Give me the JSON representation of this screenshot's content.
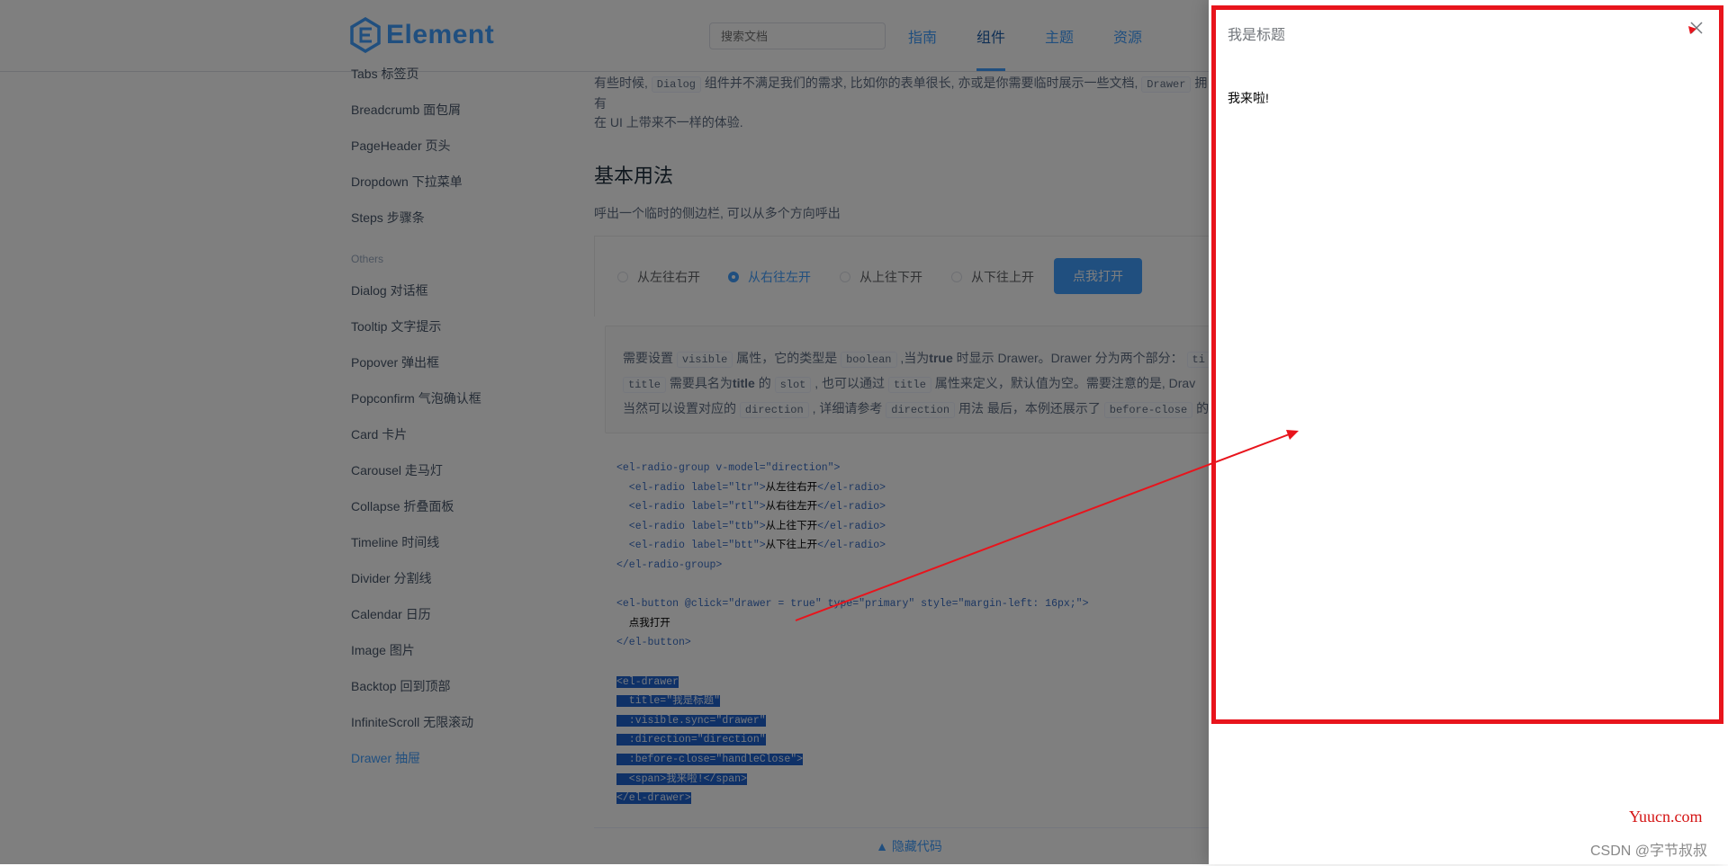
{
  "header": {
    "logo_text": "Element",
    "search_placeholder": "搜索文档",
    "nav": [
      "指南",
      "组件",
      "主题",
      "资源"
    ],
    "active_nav": "组件"
  },
  "sidebar": {
    "items_top": [
      "Tabs 标签页",
      "Breadcrumb 面包屑",
      "PageHeader 页头",
      "Dropdown 下拉菜单",
      "Steps 步骤条"
    ],
    "group_label": "Others",
    "items_others": [
      "Dialog 对话框",
      "Tooltip 文字提示",
      "Popover 弹出框",
      "Popconfirm 气泡确认框",
      "Card 卡片",
      "Carousel 走马灯",
      "Collapse 折叠面板",
      "Timeline 时间线",
      "Divider 分割线",
      "Calendar 日历",
      "Image 图片",
      "Backtop 回到顶部",
      "InfiniteScroll 无限滚动",
      "Drawer 抽屉"
    ],
    "active_item": "Drawer 抽屉"
  },
  "content": {
    "intro_a": "有些时候,",
    "intro_code1": "Dialog",
    "intro_b": "组件并不满足我们的需求, 比如你的表单很长, 亦或是你需要临时展示一些文档,",
    "intro_code2": "Drawer",
    "intro_c": "拥有",
    "intro_line2": "在 UI 上带来不一样的体验.",
    "section_title": "基本用法",
    "section_desc": "呼出一个临时的侧边栏, 可以从多个方向呼出",
    "radios": [
      {
        "label": "从左往右开",
        "checked": false
      },
      {
        "label": "从右往左开",
        "checked": true
      },
      {
        "label": "从上往下开",
        "checked": false
      },
      {
        "label": "从下往上开",
        "checked": false
      }
    ],
    "open_button": "点我打开",
    "desc": {
      "p1": "需要设置",
      "c1": "visible",
      "p2": "属性，它的类型是",
      "c2": "boolean",
      "p3": ",当为",
      "b1": "true",
      "p4": "时显示 Drawer。Drawer 分为两个部分：",
      "c3": "ti",
      "c4": "title",
      "p5": "需要具名为",
      "b2": "title",
      "p6": "的",
      "c5": "slot",
      "p7": ", 也可以通过",
      "c6": "title",
      "p8": "属性来定义，默认值为空。需要注意的是, Drav",
      "p9": "当然可以设置对应的",
      "c7": "direction",
      "p10": ", 详细请参考",
      "c8": "direction",
      "p11": "用法 最后，本例还展示了",
      "c9": "before-close",
      "p12": "的"
    },
    "code_lines": [
      "<el-radio-group v-model=\"direction\">",
      "  <el-radio label=\"ltr\">",
      "从左往右开",
      "</el-radio>",
      "  <el-radio label=\"rtl\">",
      "从右往左开",
      "</el-radio>",
      "  <el-radio label=\"ttb\">",
      "从上往下开",
      "</el-radio>",
      "  <el-radio label=\"btt\">",
      "从下往上开",
      "</el-radio>",
      "</el-radio-group>",
      "<el-button @click=\"drawer = true\" type=\"primary\" style=\"margin-left: 16px;\">",
      "  点我打开",
      "</el-button>",
      "<el-drawer",
      "  title=\"我是标题\"",
      "  :visible.sync=\"drawer\"",
      "  :direction=\"direction\"",
      "  :before-close=\"handleClose\">",
      "  <span>我来啦!</span>",
      "</el-drawer>"
    ],
    "hide_code": "▲  隐藏代码"
  },
  "drawer": {
    "title": "我是标题",
    "body": "我来啦!"
  },
  "watermark": {
    "site": "Yuucn.com",
    "author": "CSDN @字节叔叔"
  },
  "colors": {
    "primary": "#409eff",
    "annotation_red": "#e8141c"
  }
}
